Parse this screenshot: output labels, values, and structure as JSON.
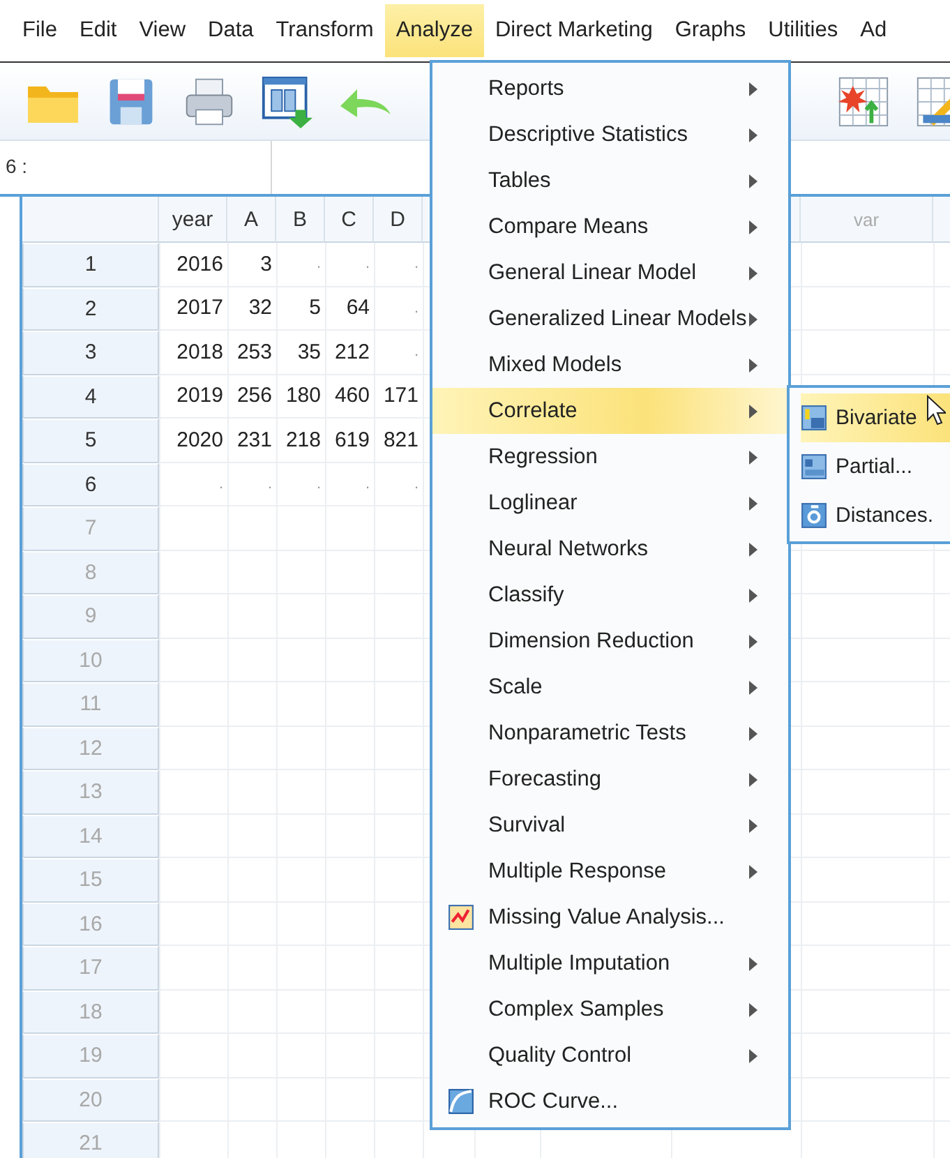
{
  "menu_bar": [
    {
      "label": "File",
      "selected": false
    },
    {
      "label": "Edit",
      "selected": false
    },
    {
      "label": "View",
      "selected": false
    },
    {
      "label": "Data",
      "selected": false
    },
    {
      "label": "Transform",
      "selected": false
    },
    {
      "label": "Analyze",
      "selected": true
    },
    {
      "label": "Direct Marketing",
      "selected": false
    },
    {
      "label": "Graphs",
      "selected": false
    },
    {
      "label": "Utilities",
      "selected": false
    },
    {
      "label": "Ad",
      "selected": false
    }
  ],
  "cell_reference": "6 :",
  "grid": {
    "columns": [
      {
        "label": "year"
      },
      {
        "label": "A"
      },
      {
        "label": "B"
      },
      {
        "label": "C"
      },
      {
        "label": "D"
      }
    ],
    "right_columns": [
      {
        "label": "var"
      }
    ],
    "rows": [
      {
        "number": "1",
        "used": true,
        "cells": [
          "2016",
          "3",
          ".",
          ".",
          "."
        ]
      },
      {
        "number": "2",
        "used": true,
        "cells": [
          "2017",
          "32",
          "5",
          "64",
          "."
        ]
      },
      {
        "number": "3",
        "used": true,
        "cells": [
          "2018",
          "253",
          "35",
          "212",
          "."
        ]
      },
      {
        "number": "4",
        "used": true,
        "cells": [
          "2019",
          "256",
          "180",
          "460",
          "171"
        ]
      },
      {
        "number": "5",
        "used": true,
        "cells": [
          "2020",
          "231",
          "218",
          "619",
          "821"
        ]
      },
      {
        "number": "6",
        "used": true,
        "cells": [
          ".",
          ".",
          ".",
          ".",
          "."
        ]
      },
      {
        "number": "7",
        "used": false
      },
      {
        "number": "8",
        "used": false
      },
      {
        "number": "9",
        "used": false
      },
      {
        "number": "10",
        "used": false
      },
      {
        "number": "11",
        "used": false
      },
      {
        "number": "12",
        "used": false
      },
      {
        "number": "13",
        "used": false
      },
      {
        "number": "14",
        "used": false
      },
      {
        "number": "15",
        "used": false
      },
      {
        "number": "16",
        "used": false
      },
      {
        "number": "17",
        "used": false
      },
      {
        "number": "18",
        "used": false
      },
      {
        "number": "19",
        "used": false
      },
      {
        "number": "20",
        "used": false
      },
      {
        "number": "21",
        "used": false
      }
    ]
  },
  "analyze_menu": {
    "items": [
      {
        "label": "Reports",
        "kind": "submenu",
        "selected": false
      },
      {
        "label": "Descriptive Statistics",
        "kind": "submenu",
        "selected": false
      },
      {
        "label": "Tables",
        "kind": "submenu",
        "selected": false
      },
      {
        "label": "Compare Means",
        "kind": "submenu",
        "selected": false
      },
      {
        "label": "General Linear Model",
        "kind": "submenu",
        "selected": false
      },
      {
        "label": "Generalized Linear Models",
        "kind": "submenu",
        "selected": false
      },
      {
        "label": "Mixed Models",
        "kind": "submenu",
        "selected": false
      },
      {
        "label": "Correlate",
        "kind": "submenu",
        "selected": true
      },
      {
        "label": "Regression",
        "kind": "submenu",
        "selected": false
      },
      {
        "label": "Loglinear",
        "kind": "submenu",
        "selected": false
      },
      {
        "label": "Neural Networks",
        "kind": "submenu",
        "selected": false
      },
      {
        "label": "Classify",
        "kind": "submenu",
        "selected": false
      },
      {
        "label": "Dimension Reduction",
        "kind": "submenu",
        "selected": false
      },
      {
        "label": "Scale",
        "kind": "submenu",
        "selected": false
      },
      {
        "label": "Nonparametric Tests",
        "kind": "submenu",
        "selected": false
      },
      {
        "label": "Forecasting",
        "kind": "submenu",
        "selected": false
      },
      {
        "label": "Survival",
        "kind": "submenu",
        "selected": false
      },
      {
        "label": "Multiple Response",
        "kind": "submenu",
        "selected": false
      },
      {
        "label": "Missing Value Analysis...",
        "kind": "dialog",
        "selected": false
      },
      {
        "label": "Multiple Imputation",
        "kind": "submenu",
        "selected": false
      },
      {
        "label": "Complex Samples",
        "kind": "submenu",
        "selected": false
      },
      {
        "label": "Quality Control",
        "kind": "submenu",
        "selected": false
      },
      {
        "label": "ROC Curve...",
        "kind": "dialog",
        "selected": false
      }
    ]
  },
  "correlate_submenu": {
    "items": [
      {
        "label": "Bivariate",
        "selected": true
      },
      {
        "label": "Partial...",
        "selected": false
      },
      {
        "label": "Distances.",
        "selected": false
      }
    ]
  }
}
